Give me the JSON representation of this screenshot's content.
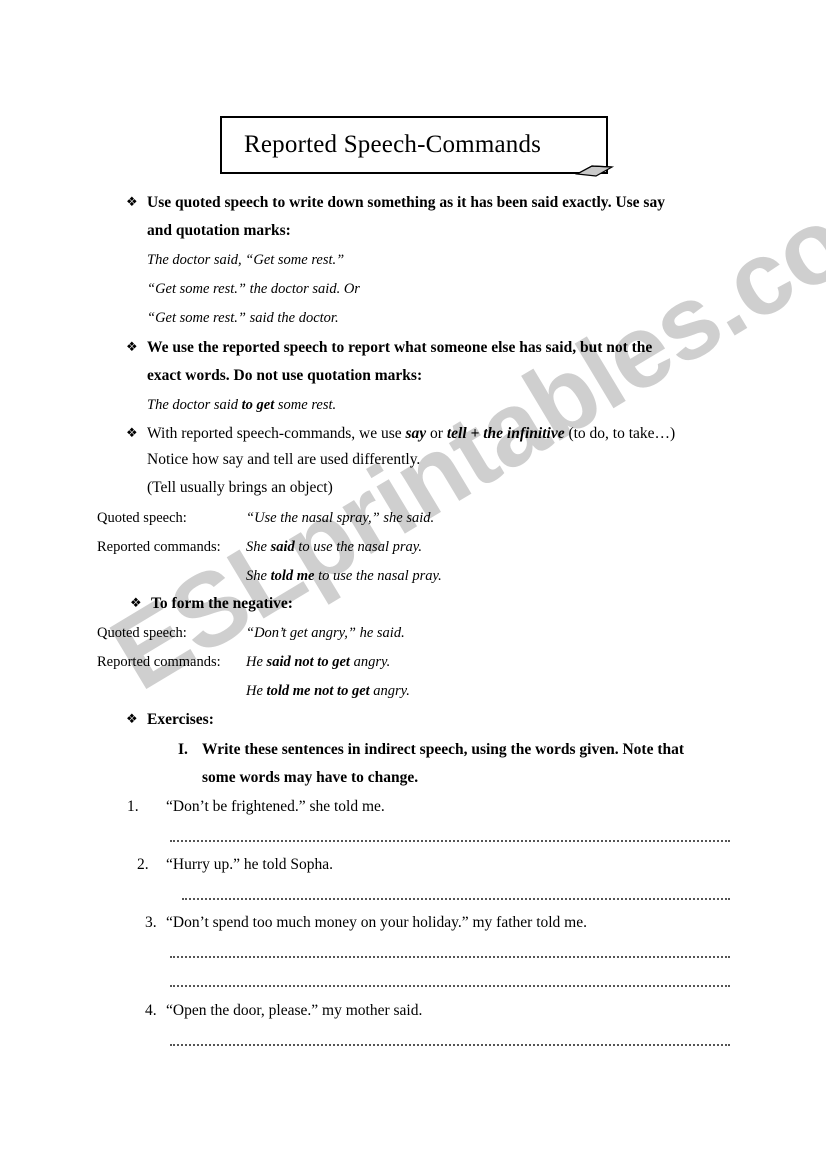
{
  "document": {
    "title": "Reported Speech-Commands",
    "watermark": "ESLprintables.com",
    "bullet_glyph": "❖"
  },
  "sections": [
    {
      "id": "quoted-speech-intro",
      "bullet": "❖",
      "heading_lines": [
        "Use quoted speech to write down something as it has been said exactly. Use say",
        "and quotation marks:"
      ],
      "examples": [
        "The doctor said, “Get some rest.”",
        "“Get some rest.” the doctor said. Or",
        "“Get some rest.” said the doctor."
      ]
    },
    {
      "id": "reported-speech-intro",
      "bullet": "❖",
      "heading_lines": [
        "We use the reported speech to report what someone else has said, but not the",
        "exact words. Do not use quotation marks:"
      ],
      "examples": [
        "The doctor said to get some rest."
      ]
    },
    {
      "id": "say-tell-infinitive",
      "bullet": "❖",
      "lines": [
        "With reported speech-commands, we use say or tell + the infinitive (to do, to take…)",
        "Notice how say and tell are used differently.",
        "(Tell usually brings an object)"
      ]
    }
  ],
  "example_table_affirmative": {
    "rows": [
      {
        "label": "Quoted speech:",
        "text": "“Use the nasal spray,” she said."
      },
      {
        "label": "Reported commands:",
        "text": "She said to use the nasal pray."
      },
      {
        "label": "",
        "text": "She told me to use the nasal pray."
      }
    ]
  },
  "negative_section": {
    "bullet": "❖",
    "heading": "To form the negative:",
    "rows": [
      {
        "label": "Quoted speech:",
        "text": "“Don’t get angry,” he said."
      },
      {
        "label": "Reported commands:",
        "text": "He said not to get angry."
      },
      {
        "label": "",
        "text": "He told me not to get angry."
      }
    ]
  },
  "exercises": {
    "bullet": "❖",
    "heading": "Exercises:",
    "task": {
      "numeral": "I.",
      "lines": [
        "Write these sentences in indirect speech, using the words given. Note that",
        "some words may have to change."
      ]
    },
    "items": [
      {
        "number": "1.",
        "text": "“Don’t be frightened.” she told me.",
        "answer_lines": 1
      },
      {
        "number": "2.",
        "text": "“Hurry up.” he told Sopha.",
        "answer_lines": 1
      },
      {
        "number": "3.",
        "text": "“Don’t spend too much money on your holiday.” my father told me.",
        "answer_lines": 2
      },
      {
        "number": "4.",
        "text": "“Open the door, please.” my mother said.",
        "answer_lines": 1
      }
    ]
  },
  "rich_text": {
    "s3_line1_a": "With reported speech-commands, we use ",
    "s3_line1_say": "say",
    "s3_line1_b": " or ",
    "s3_line1_tell": "tell + the infinitive",
    "s3_line1_c": " (to do, to take…)",
    "s2_ex_a": "The doctor said ",
    "s2_ex_bold": "to get",
    "s2_ex_b": " some rest.",
    "aff2_a": "She ",
    "aff2_bold": "said",
    "aff2_b": " to use the nasal pray.",
    "aff3_a": "She ",
    "aff3_bold": "told me",
    "aff3_b": " to use the nasal pray.",
    "neg2_a": "He ",
    "neg2_bold": "said not to get",
    "neg2_b": " angry.",
    "neg3_a": "He ",
    "neg3_bold": "told me not to get",
    "neg3_b": " angry."
  },
  "colors": {
    "ink": "#000000",
    "watermark": "#cfcfcf",
    "dotted_line": "#555555"
  }
}
